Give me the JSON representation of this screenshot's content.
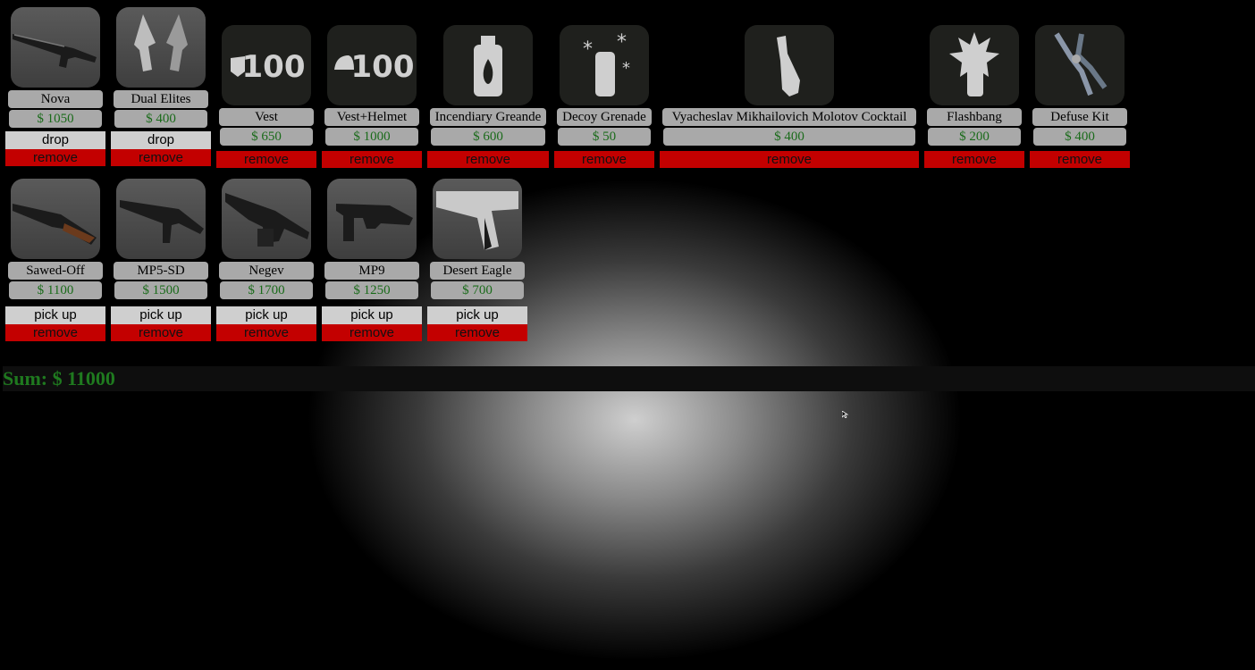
{
  "row1": [
    {
      "name": "Nova",
      "price": "$ 1050",
      "action": "drop",
      "remove": "remove",
      "icon": "nova-shotgun-icon",
      "kind": "gun",
      "hi": true
    },
    {
      "name": "Dual Elites",
      "price": "$ 400",
      "action": "drop",
      "remove": "remove",
      "icon": "dual-pistols-icon",
      "kind": "gun",
      "hi": true
    },
    {
      "name": "Vest",
      "price": "$ 650",
      "remove": "remove",
      "icon": "vest-armor-icon",
      "kind": "util",
      "armor": "100"
    },
    {
      "name": "Vest+Helmet",
      "price": "$ 1000",
      "remove": "remove",
      "icon": "vest-helmet-armor-icon",
      "kind": "util",
      "armor": "100"
    },
    {
      "name": "Incendiary Greande",
      "price": "$ 600",
      "remove": "remove",
      "icon": "incendiary-grenade-icon",
      "kind": "util"
    },
    {
      "name": "Decoy Grenade",
      "price": "$ 50",
      "remove": "remove",
      "icon": "decoy-grenade-icon",
      "kind": "util"
    },
    {
      "name": "Vyacheslav Mikhailovich Molotov Cocktail",
      "price": "$ 400",
      "remove": "remove",
      "icon": "molotov-icon",
      "kind": "util"
    },
    {
      "name": "Flashbang",
      "price": "$ 200",
      "remove": "remove",
      "icon": "flashbang-icon",
      "kind": "util"
    },
    {
      "name": "Defuse Kit",
      "price": "$ 400",
      "remove": "remove",
      "icon": "defuse-kit-icon",
      "kind": "util"
    }
  ],
  "row2": [
    {
      "name": "Sawed-Off",
      "price": "$ 1100",
      "action": "pick up",
      "remove": "remove",
      "icon": "sawed-off-shotgun-icon"
    },
    {
      "name": "MP5-SD",
      "price": "$ 1500",
      "action": "pick up",
      "remove": "remove",
      "icon": "mp5-sd-smg-icon"
    },
    {
      "name": "Negev",
      "price": "$ 1700",
      "action": "pick up",
      "remove": "remove",
      "icon": "negev-machine-gun-icon"
    },
    {
      "name": "MP9",
      "price": "$ 1250",
      "action": "pick up",
      "remove": "remove",
      "icon": "mp9-smg-icon"
    },
    {
      "name": "Desert Eagle",
      "price": "$ 700",
      "action": "pick up",
      "remove": "remove",
      "icon": "desert-eagle-pistol-icon"
    }
  ],
  "sum": "Sum: $ 11000",
  "colors": {
    "price_green": "#1a6b1a",
    "sum_green": "#1f7a1f",
    "remove_red": "#c30000",
    "chip_gray": "#a9a9a9",
    "action_gray": "#cfcfcf"
  }
}
